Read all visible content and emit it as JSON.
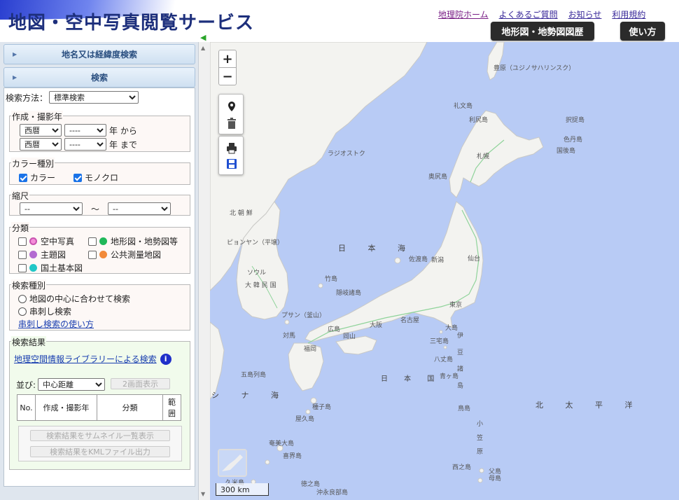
{
  "header": {
    "title": "地図・空中写真閲覧サービス",
    "links": [
      "地理院ホーム",
      "よくあるご質問",
      "お知らせ",
      "利用規約"
    ],
    "history_button": "地形図・地勢図図歴",
    "howto_button": "使い方"
  },
  "sidebar": {
    "accordion": [
      "地名又は経緯度検索",
      "検索"
    ],
    "method_label": "検索方法：",
    "method_value": "標準検索",
    "year": {
      "legend": "作成・撮影年",
      "era1": "西暦",
      "era2": "西暦",
      "year1": "----",
      "year2": "----",
      "from": "年 から",
      "to": "年 まで"
    },
    "color": {
      "legend": "カラー種別",
      "color": "カラー",
      "mono": "モノクロ"
    },
    "scale": {
      "legend": "縮尺",
      "from": "--",
      "to": "--",
      "tilde": "～"
    },
    "category": {
      "legend": "分類",
      "items": [
        "空中写真",
        "地形図・地勢図等",
        "主題図",
        "公共測量地図",
        "国土基本図"
      ],
      "colors": [
        "#f48dd9",
        "#1fb85a",
        "#b36bd1",
        "#f28a3a",
        "#21c7c7"
      ]
    },
    "search_type": {
      "legend": "検索種別",
      "opt1": "地図の中心に合わせて検索",
      "opt2": "串刺し検索",
      "link": "串刺し検索の使い方"
    },
    "results": {
      "legend": "検索結果",
      "library_link": "地理空間情報ライブラリーによる検索",
      "sort_label": "並び:",
      "sort_value": "中心距離",
      "dual_button": "2画面表示",
      "columns": [
        "No.",
        "作成・撮影年",
        "分類",
        "範囲"
      ],
      "thumb_button": "検索結果をサムネイル一覧表示",
      "kml_button": "検索結果をKMLファイル出力"
    }
  },
  "map": {
    "zoom_in": "+",
    "zoom_out": "−",
    "scale_label": "300 km",
    "labels": {
      "toyohara": "豊原（ユジノサハリンスク）",
      "rebun": "礼文島",
      "rishiri": "利尻島",
      "etorofu": "択捉島",
      "shikotan": "色丹島",
      "kunashiri": "国後島",
      "vladivostok": "ラジオストク",
      "sapporo": "札幌",
      "okushiri": "奥尻島",
      "kitachosen": "北 朝 鮮",
      "pyongyang": "ピョンヤン（平壌）",
      "sea_of_japan": "日 本 海",
      "sado": "佐渡島",
      "niigata": "新潟",
      "sendai": "仙台",
      "seoul": "ソウル",
      "korea": "大 韓 民 国",
      "takeshima": "竹島",
      "oki": "隠岐諸島",
      "tokyo": "東京",
      "busan": "プサン（釜山）",
      "nagoya": "名古屋",
      "osaka": "大阪",
      "hiroshima": "広島",
      "okayama": "岡山",
      "tsushima": "対馬",
      "fukuoka": "福岡",
      "oshima": "大島",
      "miyake": "三宅島",
      "izu": "伊 豆 諸 島",
      "hachijo": "八丈島",
      "aogashima": "青ヶ島",
      "goto": "五島列島",
      "japan": "日 本 国",
      "east_china_sea": "シ ナ 海",
      "pacific": "北 太 平 洋",
      "torishima": "鳥島",
      "tanegashima": "種子島",
      "yakushima": "屋久島",
      "ogasawara": "小 笠 原",
      "nishinoshima": "西之島",
      "amami": "奄美大島",
      "kikai": "喜界島",
      "tokunoshima": "徳之島",
      "okinoerabu": "沖永良部島",
      "kume": "久米島",
      "chichijima": "父島",
      "hahajima": "母島"
    }
  }
}
